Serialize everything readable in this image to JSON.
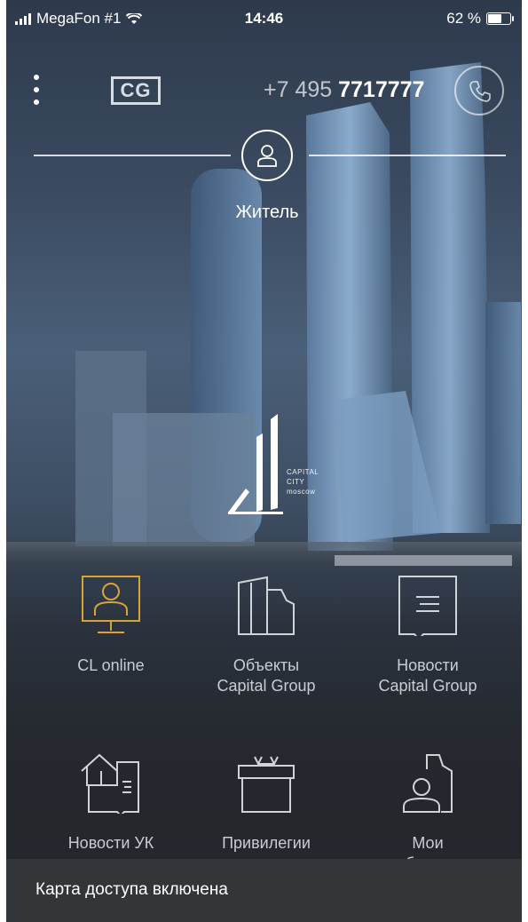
{
  "status_bar": {
    "carrier": "MegaFon #1",
    "time": "14:46",
    "battery": "62 %"
  },
  "header": {
    "logo": "CG",
    "phone_prefix": "+7 495 ",
    "phone_number": "7717777"
  },
  "user": {
    "role": "Житель"
  },
  "brand": {
    "line1": "CAPITAL",
    "line2": "CITY",
    "line3": "moscow"
  },
  "menu": [
    {
      "label": "CL online",
      "icon": "monitor-user-icon",
      "highlight": true
    },
    {
      "label": "Объекты\nCapital Group",
      "icon": "buildings-icon"
    },
    {
      "label": "Новости\nCapital Group",
      "icon": "news-message-icon"
    },
    {
      "label": "Новости УК",
      "icon": "house-news-icon"
    },
    {
      "label": "Привилегии\nи скидки",
      "icon": "gift-icon"
    },
    {
      "label": "Мои\nобъекты",
      "icon": "user-building-icon"
    }
  ],
  "toast": {
    "text": "Карта доступа включена"
  },
  "colors": {
    "accent": "#d6a53a",
    "icon": "#d0d3d8",
    "toast_bg": "#333639"
  }
}
